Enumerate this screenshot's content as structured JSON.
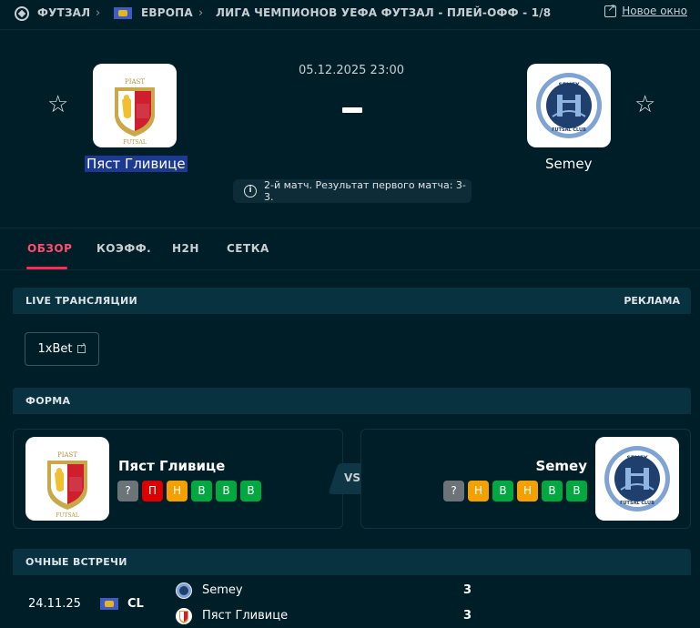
{
  "breadcrumb": {
    "sport": "ФУТЗАЛ",
    "region": "ЕВРОПА",
    "competition": "ЛИГА ЧЕМПИОНОВ УЕФА ФУТЗАЛ - ПЛЕЙ-ОФФ - 1/8"
  },
  "new_window_label": "Новое окно",
  "match": {
    "datetime": "05.12.2025 23:00",
    "score_separator": "–",
    "home": {
      "name": "Пяст Гливице",
      "logo_text_top": "PIAST",
      "logo_text_bottom": "FUTSAL"
    },
    "away": {
      "name": "Semey",
      "logo_text_top": "SEMEY",
      "logo_text_bottom": "FUTSAL CLUB"
    },
    "info": "2-й матч. Результат первого матча: 3-3."
  },
  "tabs": [
    {
      "label": "ОБЗОР",
      "active": true
    },
    {
      "label": "КОЭФФ.",
      "active": false
    },
    {
      "label": "H2H",
      "active": false
    },
    {
      "label": "СЕТКА",
      "active": false
    }
  ],
  "live": {
    "title": "LIVE ТРАНСЛЯЦИИ",
    "ad_label": "РЕКЛАМА",
    "bookmaker": "1xBet"
  },
  "form": {
    "title": "ФОРМА",
    "vs_label": "VS",
    "home": {
      "name": "Пяст Гливице",
      "results": [
        "?",
        "П",
        "Н",
        "В",
        "В",
        "В"
      ]
    },
    "away": {
      "name": "Semey",
      "results": [
        "?",
        "Н",
        "В",
        "Н",
        "В",
        "В"
      ]
    }
  },
  "h2h": {
    "title": "ОЧНЫЕ ВСТРЕЧИ",
    "matches": [
      {
        "date": "24.11.25",
        "competition": "CL",
        "team1": "Semey",
        "score1": "3",
        "team2": "Пяст Гливице",
        "score2": "3"
      }
    ]
  },
  "colors": {
    "background": "#001e28",
    "accent": "#ff2d55",
    "win": "#00a83f",
    "draw": "#f3a000",
    "loss": "#dc0000",
    "unknown": "#6c7478",
    "selection": "#1c3a91"
  }
}
